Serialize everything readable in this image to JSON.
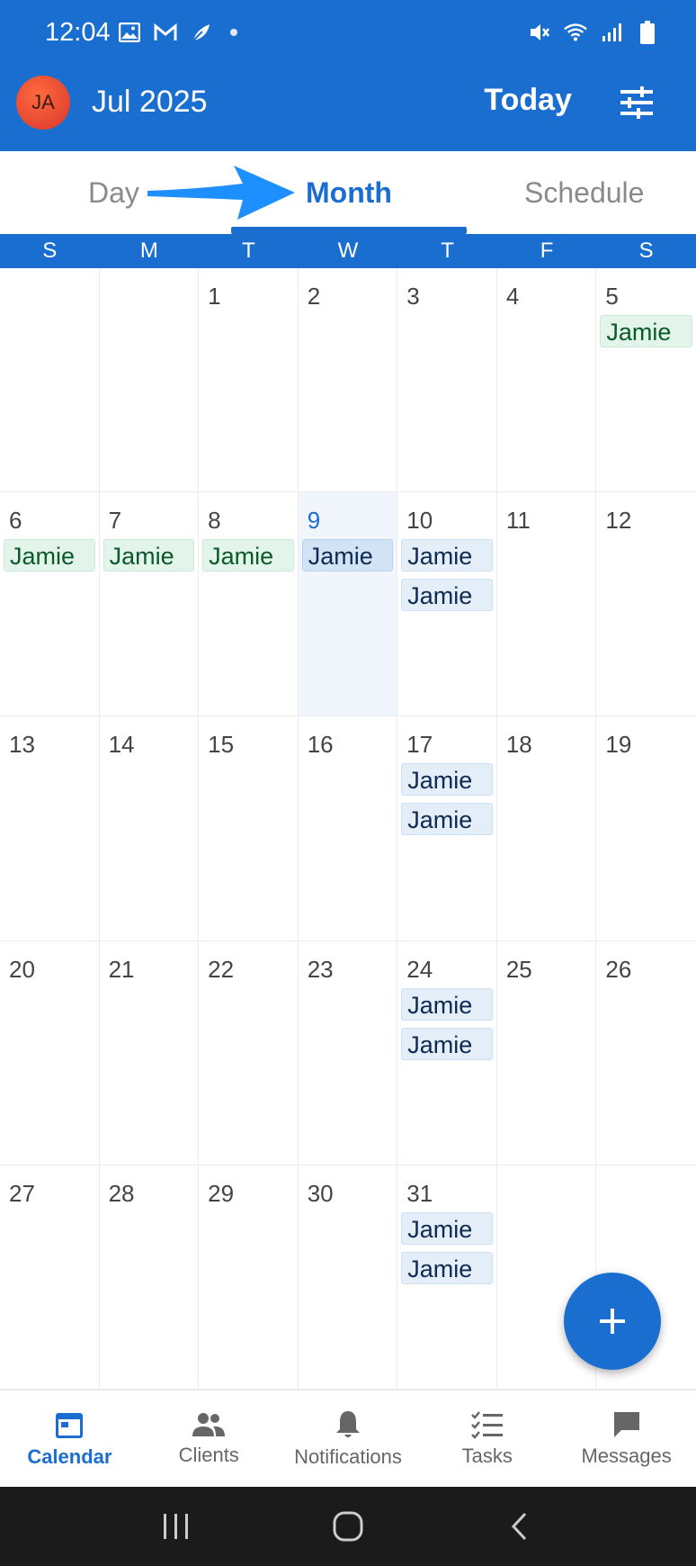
{
  "status_bar": {
    "time": "12:04",
    "left_icons": [
      "gallery-icon",
      "gmail-icon",
      "phone-leaf-icon",
      "dot"
    ],
    "right_icons": [
      "mute-icon",
      "wifi-icon",
      "signal-icon",
      "battery-icon"
    ]
  },
  "app_bar": {
    "avatar_initials": "JA",
    "month_title": "Jul 2025",
    "today_label": "Today",
    "settings_icon": "tune-icon"
  },
  "tabs": [
    {
      "label": "Day",
      "active": false
    },
    {
      "label": "Month",
      "active": true
    },
    {
      "label": "Schedule",
      "active": false
    }
  ],
  "weekdays": [
    "S",
    "M",
    "T",
    "W",
    "T",
    "F",
    "S"
  ],
  "weeks": [
    [
      {
        "day": "",
        "events": []
      },
      {
        "day": "",
        "events": []
      },
      {
        "day": "1",
        "events": []
      },
      {
        "day": "2",
        "events": []
      },
      {
        "day": "3",
        "events": []
      },
      {
        "day": "4",
        "events": []
      },
      {
        "day": "5",
        "events": [
          {
            "label": "Jamie",
            "color": "green"
          }
        ]
      }
    ],
    [
      {
        "day": "6",
        "events": [
          {
            "label": "Jamie",
            "color": "green"
          }
        ]
      },
      {
        "day": "7",
        "events": [
          {
            "label": "Jamie",
            "color": "green"
          }
        ]
      },
      {
        "day": "8",
        "events": [
          {
            "label": "Jamie",
            "color": "green"
          }
        ]
      },
      {
        "day": "9",
        "today": true,
        "events": [
          {
            "label": "Jamie",
            "color": "blue-today"
          }
        ]
      },
      {
        "day": "10",
        "events": [
          {
            "label": "Jamie",
            "color": "blue"
          },
          {
            "label": "Jamie",
            "color": "blue"
          }
        ]
      },
      {
        "day": "11",
        "events": []
      },
      {
        "day": "12",
        "events": []
      }
    ],
    [
      {
        "day": "13",
        "events": []
      },
      {
        "day": "14",
        "events": []
      },
      {
        "day": "15",
        "events": []
      },
      {
        "day": "16",
        "events": []
      },
      {
        "day": "17",
        "events": [
          {
            "label": "Jamie",
            "color": "blue"
          },
          {
            "label": "Jamie",
            "color": "blue"
          }
        ]
      },
      {
        "day": "18",
        "events": []
      },
      {
        "day": "19",
        "events": []
      }
    ],
    [
      {
        "day": "20",
        "events": []
      },
      {
        "day": "21",
        "events": []
      },
      {
        "day": "22",
        "events": []
      },
      {
        "day": "23",
        "events": []
      },
      {
        "day": "24",
        "events": [
          {
            "label": "Jamie",
            "color": "blue"
          },
          {
            "label": "Jamie",
            "color": "blue"
          }
        ]
      },
      {
        "day": "25",
        "events": []
      },
      {
        "day": "26",
        "events": []
      }
    ],
    [
      {
        "day": "27",
        "events": []
      },
      {
        "day": "28",
        "events": []
      },
      {
        "day": "29",
        "events": []
      },
      {
        "day": "30",
        "events": []
      },
      {
        "day": "31",
        "events": [
          {
            "label": "Jamie",
            "color": "blue"
          },
          {
            "label": "Jamie",
            "color": "blue"
          }
        ]
      },
      {
        "day": "",
        "events": []
      },
      {
        "day": "",
        "events": []
      }
    ]
  ],
  "fab": {
    "icon": "plus-icon"
  },
  "bottom_nav": [
    {
      "label": "Calendar",
      "icon": "calendar-icon",
      "active": true
    },
    {
      "label": "Clients",
      "icon": "people-icon",
      "active": false
    },
    {
      "label": "Notifications",
      "icon": "bell-icon",
      "active": false
    },
    {
      "label": "Tasks",
      "icon": "checklist-icon",
      "active": false
    },
    {
      "label": "Messages",
      "icon": "chat-icon",
      "active": false
    }
  ],
  "system_nav": [
    "recents-icon",
    "home-icon",
    "back-icon"
  ],
  "colors": {
    "primary": "#1a6ecf",
    "event_green_bg": "#e3f5ea",
    "event_green_text": "#0b5a2c",
    "event_blue_bg": "#e4eef9",
    "event_blue_text": "#0f2a52",
    "today_cell_bg": "#f1f6fc",
    "annotation_arrow": "#1e8fff"
  }
}
